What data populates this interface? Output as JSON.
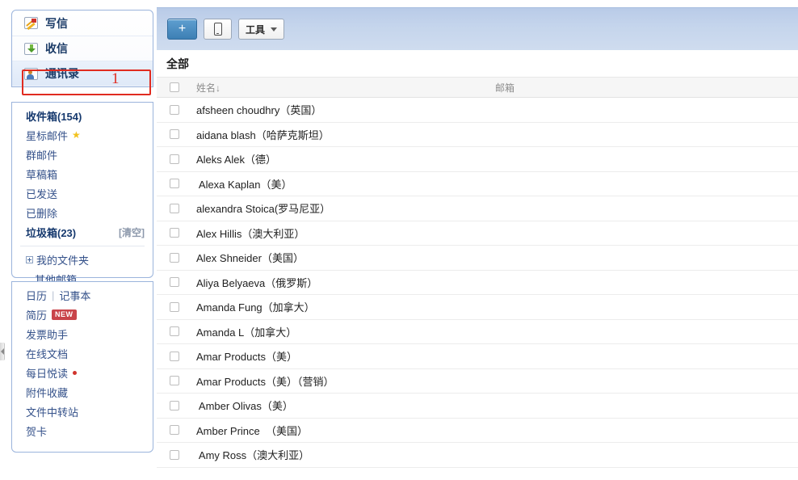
{
  "sidebar": {
    "nav": [
      {
        "label": "写信",
        "icon": "compose-icon"
      },
      {
        "label": "收信",
        "icon": "inbox-icon"
      },
      {
        "label": "通讯录",
        "icon": "contacts-icon"
      }
    ],
    "annotation": {
      "number": "1",
      "color": "#e02b20"
    },
    "folders": [
      {
        "label": "收件箱(154)",
        "bold": true
      },
      {
        "label": "星标邮件",
        "star": "★"
      },
      {
        "label": "群邮件"
      },
      {
        "label": "草稿箱"
      },
      {
        "label": "已发送"
      },
      {
        "label": "已删除"
      },
      {
        "label": "垃圾箱(23)",
        "bold": true,
        "action": "[清空]"
      }
    ],
    "my_folders": {
      "label": "我的文件夹",
      "expander": "plus-box-icon"
    },
    "other_mailbox": {
      "label": "其他邮箱"
    },
    "apps": {
      "calendar": "日历",
      "separator": "|",
      "notebook": "记事本",
      "resume": "简历",
      "resume_badge": "NEW",
      "invoice": "发票助手",
      "online_doc": "在线文档",
      "daily_read": "每日悦读",
      "attachment_fav": "附件收藏",
      "file_transfer": "文件中转站",
      "greeting_card": "贺卡"
    }
  },
  "toolbar": {
    "add_label": "+",
    "phone_label": "",
    "tools_label": "工具"
  },
  "main": {
    "heading": "全部",
    "columns": {
      "name": "姓名↓",
      "email": "邮箱"
    },
    "contacts": [
      {
        "name": "afsheen choudhry（英国）"
      },
      {
        "name": "aidana blash（哈萨克斯坦）"
      },
      {
        "name": "Aleks Alek（德）"
      },
      {
        "name": " Alexa Kaplan（美）"
      },
      {
        "name": "alexandra Stoica(罗马尼亚）"
      },
      {
        "name": "Alex Hillis（澳大利亚）"
      },
      {
        "name": "Alex Shneider（美国）"
      },
      {
        "name": "Aliya Belyaeva（俄罗斯）"
      },
      {
        "name": "Amanda Fung（加拿大）"
      },
      {
        "name": "Amanda L（加拿大）"
      },
      {
        "name": "Amar Products（美）"
      },
      {
        "name": "Amar Products（美）（营销）"
      },
      {
        "name": " Amber Olivas（美）"
      },
      {
        "name": "Amber Prince  （美国）"
      },
      {
        "name": " Amy Ross（澳大利亚）"
      }
    ]
  }
}
